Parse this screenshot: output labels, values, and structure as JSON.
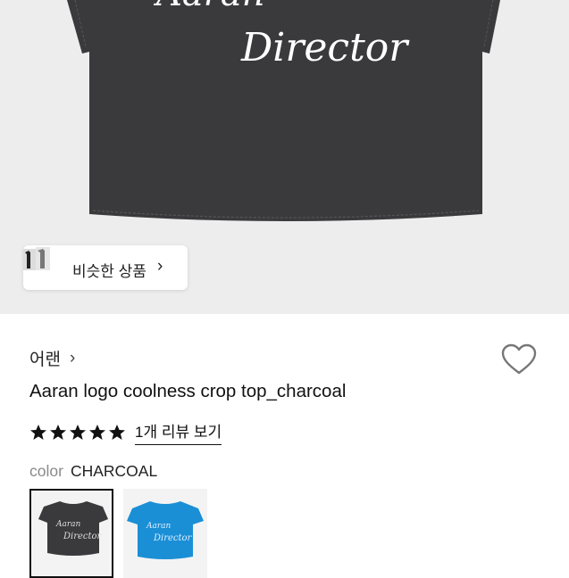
{
  "hero": {
    "print_text": "Director",
    "print_text_partial": "Aaran",
    "similar_products_label": "비슷한 상품",
    "similar_chevron": "›"
  },
  "product": {
    "brand": "어랜",
    "brand_chevron": "›",
    "title": "Aaran logo coolness crop top_charcoal",
    "rating_stars": 5,
    "review_link": "1개 리뷰 보기",
    "color_label": "color",
    "color_value": "CHARCOAL"
  },
  "swatches": [
    {
      "name": "charcoal",
      "color": "#3a3a3c",
      "line1": "Aaran",
      "line2": "Director",
      "selected": true
    },
    {
      "name": "blue",
      "color": "#1a8fd6",
      "line1": "Aaran",
      "line2": "Director",
      "selected": false
    }
  ],
  "colors": {
    "shirt_charcoal": "#3a3a3c",
    "shirt_blue": "#1a8fd6",
    "hero_bg": "#ededee",
    "star": "#111111"
  }
}
